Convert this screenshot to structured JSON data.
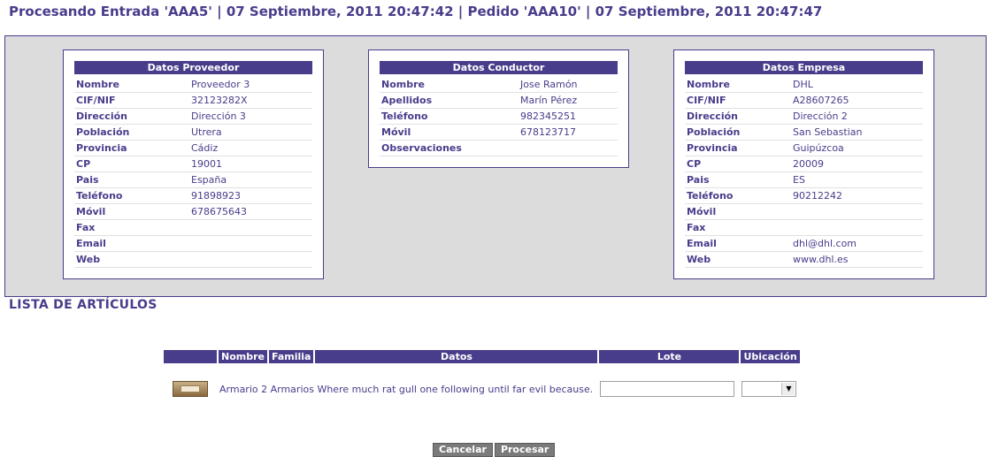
{
  "header": {
    "title": "Procesando Entrada 'AAA5' | 07 Septiembre, 2011 20:47:42 | Pedido 'AAA10' | 07 Septiembre, 2011 20:47:47"
  },
  "proveedor": {
    "title": "Datos Proveedor",
    "rows": [
      {
        "label": "Nombre",
        "value": "Proveedor 3"
      },
      {
        "label": "CIF/NIF",
        "value": "32123282X"
      },
      {
        "label": "Dirección",
        "value": "Dirección 3"
      },
      {
        "label": "Población",
        "value": "Utrera"
      },
      {
        "label": "Provincia",
        "value": "Cádiz"
      },
      {
        "label": "CP",
        "value": "19001"
      },
      {
        "label": "Pais",
        "value": "España"
      },
      {
        "label": "Teléfono",
        "value": "91898923"
      },
      {
        "label": "Móvil",
        "value": "678675643"
      },
      {
        "label": "Fax",
        "value": ""
      },
      {
        "label": "Email",
        "value": ""
      },
      {
        "label": "Web",
        "value": ""
      }
    ]
  },
  "conductor": {
    "title": "Datos Conductor",
    "rows": [
      {
        "label": "Nombre",
        "value": "Jose Ramón"
      },
      {
        "label": "Apellidos",
        "value": "Marín Pérez"
      },
      {
        "label": "Teléfono",
        "value": "982345251"
      },
      {
        "label": "Móvil",
        "value": "678123717"
      },
      {
        "label": "Observaciones",
        "value": ""
      }
    ]
  },
  "empresa": {
    "title": "Datos Empresa",
    "rows": [
      {
        "label": "Nombre",
        "value": "DHL"
      },
      {
        "label": "CIF/NIF",
        "value": "A28607265"
      },
      {
        "label": "Dirección",
        "value": "Dirección 2"
      },
      {
        "label": "Población",
        "value": "San Sebastian"
      },
      {
        "label": "Provincia",
        "value": "Guipúzcoa"
      },
      {
        "label": "CP",
        "value": "20009"
      },
      {
        "label": "Pais",
        "value": "ES"
      },
      {
        "label": "Teléfono",
        "value": "90212242"
      },
      {
        "label": "Móvil",
        "value": ""
      },
      {
        "label": "Fax",
        "value": ""
      },
      {
        "label": "Email",
        "value": "dhl@dhl.com"
      },
      {
        "label": "Web",
        "value": "www.dhl.es"
      }
    ]
  },
  "articulos": {
    "section_title": "LISTA DE ARTÍCULOS",
    "columns": [
      "",
      "Nombre",
      "Familia",
      "Datos",
      "Lote",
      "Ubicación"
    ],
    "rows": [
      {
        "image_icon": "cabinet-thumbnail",
        "text": "Armario 2 Armarios Where much rat gull one following until far evil because.",
        "lote": "",
        "ubicacion": ""
      }
    ]
  },
  "actions": {
    "cancel_label": "Cancelar",
    "process_label": "Procesar"
  },
  "colors": {
    "accent": "#483d8b",
    "panel_bg": "#dcdcdc",
    "button_bg": "#7a7a7a"
  }
}
